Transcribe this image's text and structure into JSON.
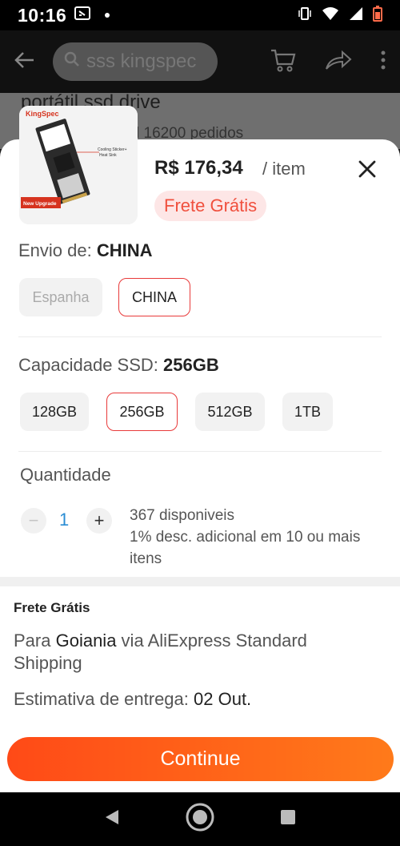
{
  "status_bar": {
    "time": "10:16"
  },
  "header": {
    "search_text": "sss kingspec"
  },
  "background_product": {
    "title": "portátil ssd drive",
    "orders": "l 16200 pedidos"
  },
  "product_image": {
    "brand": "KingSpec",
    "tag": "New Upgrade",
    "callout": "Cooling Sticker+ Heat Sink"
  },
  "sheet": {
    "price": "R$ 176,34",
    "unit": "/ item",
    "shipping_badge": "Frete Grátis",
    "ship_from": {
      "label": "Envio de:",
      "value": "CHINA",
      "options": [
        "Espanha",
        "CHINA"
      ],
      "selected": "CHINA",
      "disabled": [
        "Espanha"
      ]
    },
    "capacity": {
      "label": "Capacidade SSD:",
      "value": "256GB",
      "options": [
        "128GB",
        "256GB",
        "512GB",
        "1TB"
      ],
      "selected": "256GB"
    },
    "quantity": {
      "label": "Quantidade",
      "minus": "−",
      "plus": "+",
      "value": "1",
      "stock": "367 disponiveis",
      "discount": "1% desc. adicional em 10 ou mais itens"
    },
    "shipping": {
      "title": "Frete Grátis",
      "to_prefix": "Para ",
      "city": "Goiania",
      "via": " via AliExpress Standard Shipping",
      "estimate_label": "Estimativa de entrega: ",
      "estimate_date": "02 Out."
    },
    "continue_label": "Continue"
  },
  "colors": {
    "accent": "#e83a3a",
    "button_start": "#ff4a17",
    "button_end": "#ff7a1a",
    "badge_bg": "#fde6e6",
    "qty": "#2a8dd4"
  }
}
